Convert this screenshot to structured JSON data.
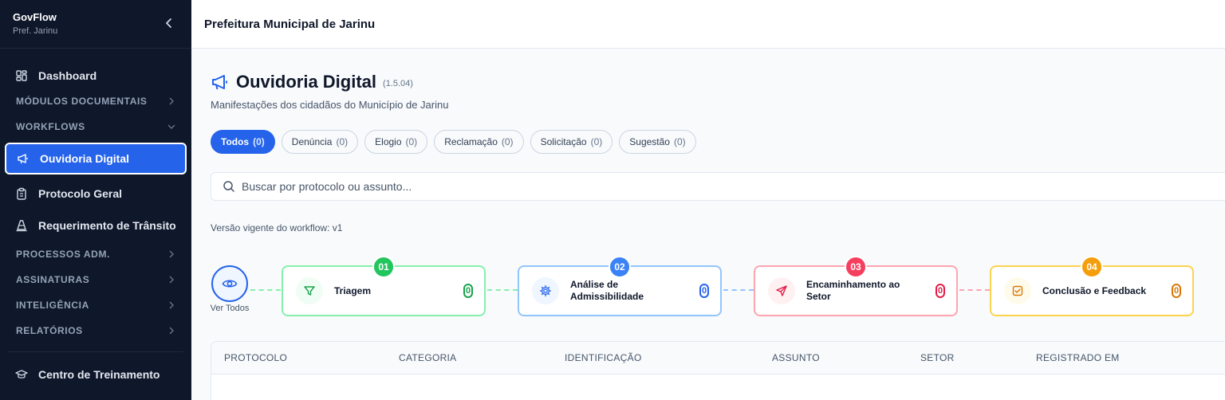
{
  "sidebar": {
    "brand": "GovFlow",
    "org": "Pref. Jarinu",
    "items": [
      {
        "type": "item",
        "label": "Dashboard",
        "icon": "layout-grid-icon"
      },
      {
        "type": "section",
        "label": "MÓDULOS DOCUMENTAIS",
        "chevron": "right"
      },
      {
        "type": "section",
        "label": "WORKFLOWS",
        "chevron": "down"
      },
      {
        "type": "item",
        "label": "Ouvidoria Digital",
        "icon": "megaphone-icon",
        "active": true
      },
      {
        "type": "item",
        "label": "Protocolo Geral",
        "icon": "clipboard-icon"
      },
      {
        "type": "item",
        "label": "Requerimento de Trânsito",
        "icon": "traffic-cone-icon"
      },
      {
        "type": "section",
        "label": "PROCESSOS ADM.",
        "chevron": "right"
      },
      {
        "type": "section",
        "label": "ASSINATURAS",
        "chevron": "right"
      },
      {
        "type": "section",
        "label": "INTELIGÊNCIA",
        "chevron": "right"
      },
      {
        "type": "section",
        "label": "RELATÓRIOS",
        "chevron": "right"
      }
    ],
    "footer_item": {
      "label": "Centro de Treinamento",
      "icon": "graduation-cap-icon"
    }
  },
  "topbar": {
    "title": "Prefeitura Municipal de Jarinu"
  },
  "page": {
    "title": "Ouvidoria Digital",
    "version": "(1.5.04)",
    "subtitle": "Manifestações dos cidadãos do Município de Jarinu"
  },
  "filters": [
    {
      "label": "Todos",
      "count": "(0)",
      "active": true
    },
    {
      "label": "Denúncia",
      "count": "(0)"
    },
    {
      "label": "Elogio",
      "count": "(0)"
    },
    {
      "label": "Reclamação",
      "count": "(0)"
    },
    {
      "label": "Solicitação",
      "count": "(0)"
    },
    {
      "label": "Sugestão",
      "count": "(0)"
    }
  ],
  "search": {
    "placeholder": "Buscar por protocolo ou assunto...",
    "value": ""
  },
  "workflow": {
    "version_text": "Versão vigente do workflow: v1",
    "view_all_label": "Ver Todos",
    "stages": [
      {
        "num": "01",
        "name_lines": [
          "Triagem"
        ],
        "count": "0",
        "color": "#22c55e",
        "border": "#86efac",
        "icon": "filter-icon"
      },
      {
        "num": "02",
        "name_lines": [
          "Análise de",
          "Admissibilidade"
        ],
        "count": "0",
        "color": "#3b82f6",
        "border": "#93c5fd",
        "icon": "settings-icon"
      },
      {
        "num": "03",
        "name_lines": [
          "Encaminhamento ao",
          "Setor"
        ],
        "count": "0",
        "color": "#f43f5e",
        "border": "#fda4af",
        "icon": "send-icon"
      },
      {
        "num": "04",
        "name_lines": [
          "Conclusão e Feedback"
        ],
        "count": "0",
        "color": "#f59e0b",
        "border": "#fcd34d",
        "icon": "check-square-icon"
      }
    ]
  },
  "table": {
    "columns": [
      "PROTOCOLO",
      "CATEGORIA",
      "IDENTIFICAÇÃO",
      "ASSUNTO",
      "SETOR",
      "REGISTRADO EM"
    ]
  },
  "colors": {
    "accent": "#2563eb",
    "sidebar_bg": "#0f172a"
  }
}
